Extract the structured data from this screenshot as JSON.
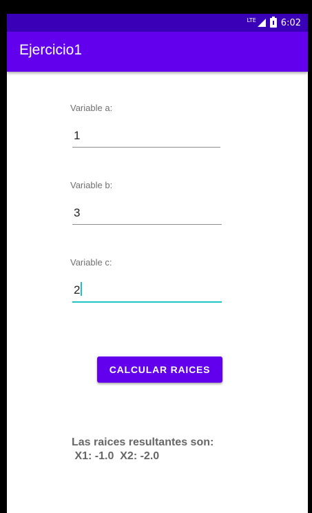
{
  "status_bar": {
    "time": "6:02",
    "network": "LTE"
  },
  "toolbar": {
    "title": "Ejercicio1"
  },
  "fields": [
    {
      "label": "Variable a:",
      "value": "1"
    },
    {
      "label": "Variable b:",
      "value": "3"
    },
    {
      "label": "Variable c:",
      "value": "2"
    }
  ],
  "button": {
    "label": "CALCULAR RAICES"
  },
  "result": {
    "line1": "Las raices resultantes son:",
    "line2": " X1: -1.0  X2: -2.0"
  },
  "colors": {
    "primary": "#6200ee",
    "primary_dark": "#3a00b8",
    "accent": "#1ec4c4"
  }
}
